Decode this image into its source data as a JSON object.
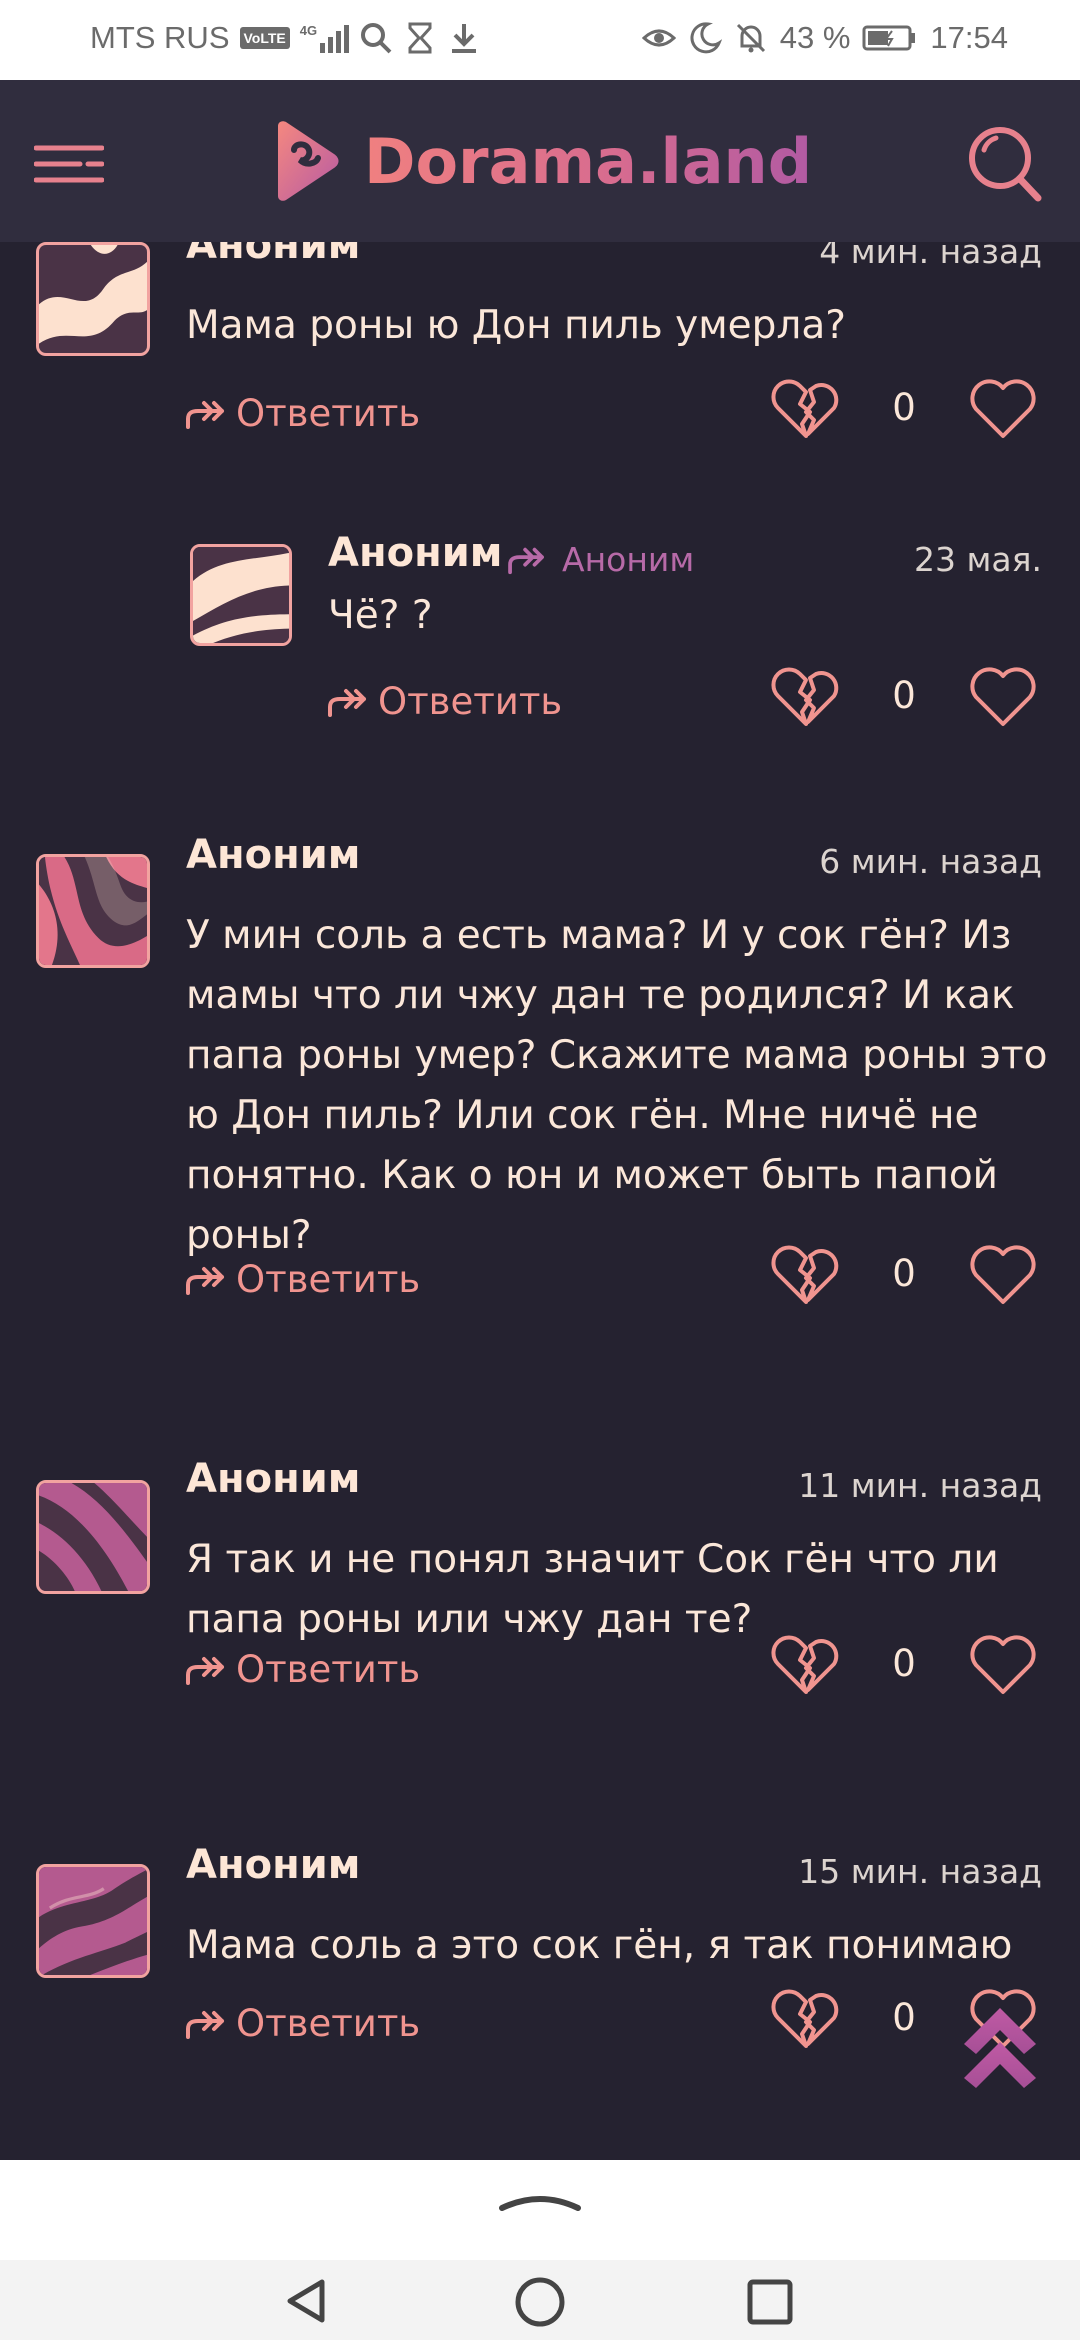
{
  "status_bar": {
    "carrier": "MTS RUS",
    "volte": "VoLTE",
    "network": "4G",
    "battery": "43 %",
    "time": "17:54"
  },
  "header": {
    "logo_text": "Dorama.land"
  },
  "comments": [
    {
      "author": "Аноним",
      "time": "4 мин. назад",
      "text": "Мама роны ю Дон пиль умерла?",
      "reply_label": "Ответить",
      "score": "0"
    },
    {
      "author": "Аноним",
      "reply_to": "Аноним",
      "time": "23 мая.",
      "text": "Чё? ?",
      "reply_label": "Ответить",
      "score": "0"
    },
    {
      "author": "Аноним",
      "time": "6 мин. назад",
      "text": "У мин соль а есть мама? И у сок гён? Из\nмамы что ли чжу дан те родился? И как\nпапа роны умер? Скажите мама роны это\nю Дон пиль? Или сок гён. Мне ничё не\nпонятно. Как о юн и может быть папой\nроны?",
      "reply_label": "Ответить",
      "score": "0"
    },
    {
      "author": "Аноним",
      "time": "11 мин. назад",
      "text": "Я так и не понял значит Сок гён что ли\nпапа роны или чжу дан те?",
      "reply_label": "Ответить",
      "score": "0"
    },
    {
      "author": "Аноним",
      "time": "15 мин. назад",
      "text": "Мама соль а это сок гён, я так понимаю",
      "reply_label": "Ответить",
      "score": "0"
    }
  ],
  "colors": {
    "background": "#252230",
    "header": "#302d3e",
    "accent": "#f0948f",
    "secondary_accent": "#b76aa8",
    "text": "#fbe7d9"
  }
}
